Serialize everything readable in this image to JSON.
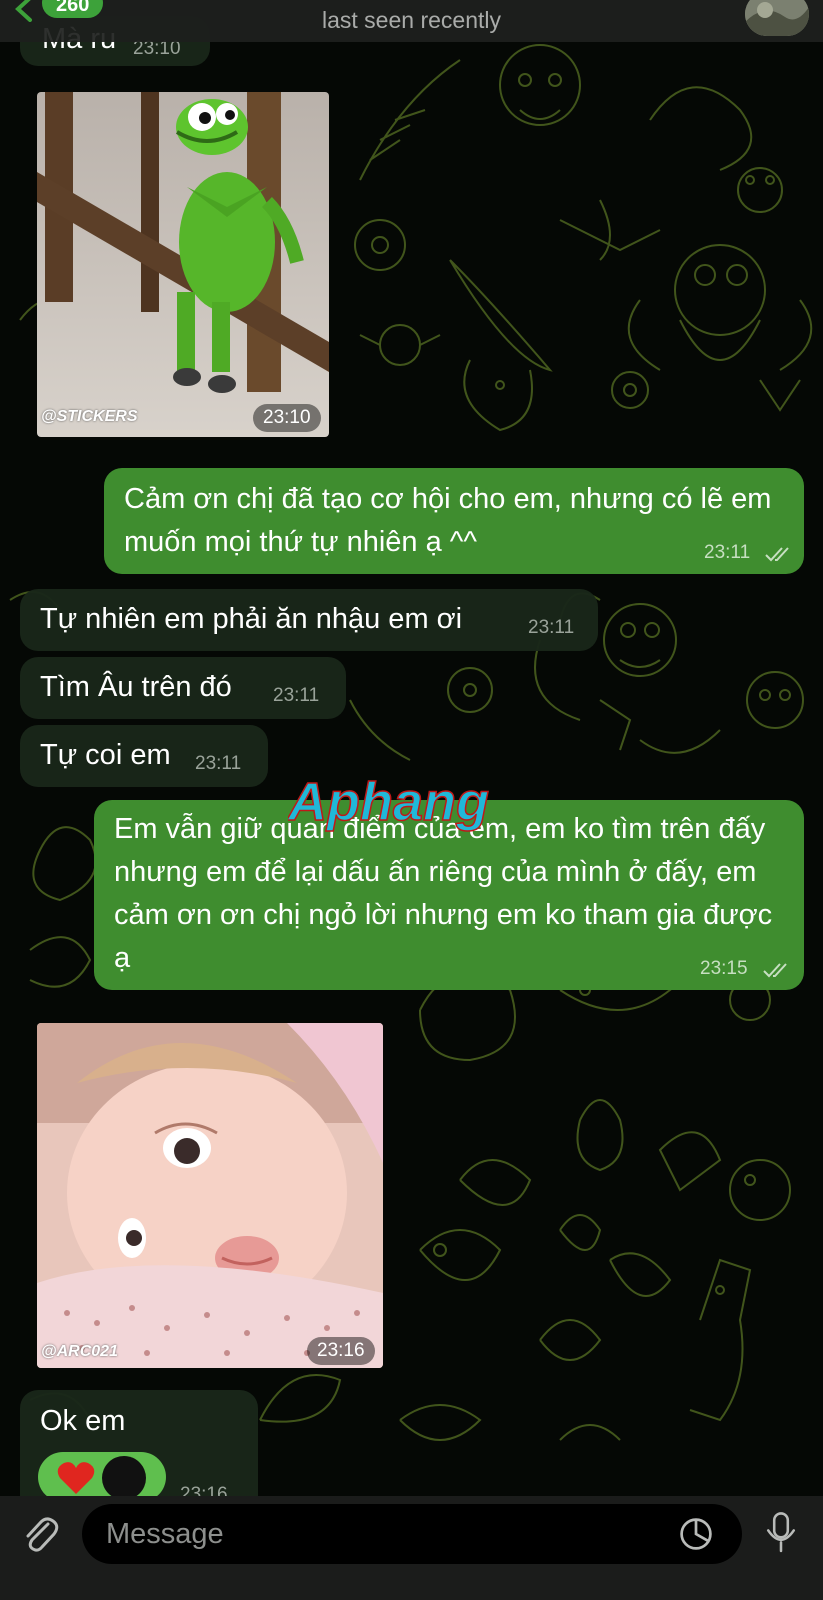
{
  "header": {
    "unread_count": "260",
    "status": "last seen recently"
  },
  "messages": [
    {
      "kind": "text",
      "dir": "in",
      "text": "Mà ru",
      "time": "23:10"
    },
    {
      "kind": "sticker",
      "dir": "in",
      "image": "kermit-frog-sticker",
      "caption": "@STICKERS",
      "time": "23:10"
    },
    {
      "kind": "text",
      "dir": "out",
      "text": "Cảm ơn chị đã tạo cơ hội cho em, nhưng có lẽ em muốn mọi thứ tự nhiên ạ ^^",
      "time": "23:11"
    },
    {
      "kind": "text",
      "dir": "in",
      "text": "Tự nhiên em phải ăn nhậu em ơi",
      "time": "23:11"
    },
    {
      "kind": "text",
      "dir": "in",
      "text": "Tìm Âu trên đó",
      "time": "23:11"
    },
    {
      "kind": "text",
      "dir": "in",
      "text": "Tự coi em",
      "time": "23:11"
    },
    {
      "kind": "text",
      "dir": "out",
      "text": "Em vẫn giữ quan điểm của em, em ko tìm trên đấy nhưng em để lại dấu ấn riêng của mình ở đấy, em cảm ơn ơn chị ngỏ lời nhưng em ko tham gia được ạ",
      "time": "23:15"
    },
    {
      "kind": "sticker",
      "dir": "in",
      "image": "baby-sticker",
      "caption": "@ARC021",
      "time": "23:16"
    },
    {
      "kind": "text",
      "dir": "in",
      "text": "Ok em",
      "time": "23:16",
      "reactions": [
        "heart-reaction-icon",
        "avatar-reaction-icon"
      ]
    }
  ],
  "watermark": {
    "text": "Aphang"
  },
  "input": {
    "placeholder": "Message"
  },
  "icons": [
    "back-chevron-icon",
    "attach-icon",
    "sticker-icon",
    "microphone-icon",
    "read-checkmarks-icon"
  ],
  "colors": {
    "outgoing_bubble": "#3f8d2f",
    "incoming_bubble": "#192619",
    "badge": "#3da23a",
    "background": "#050805",
    "pattern": "#4a5f1a"
  }
}
